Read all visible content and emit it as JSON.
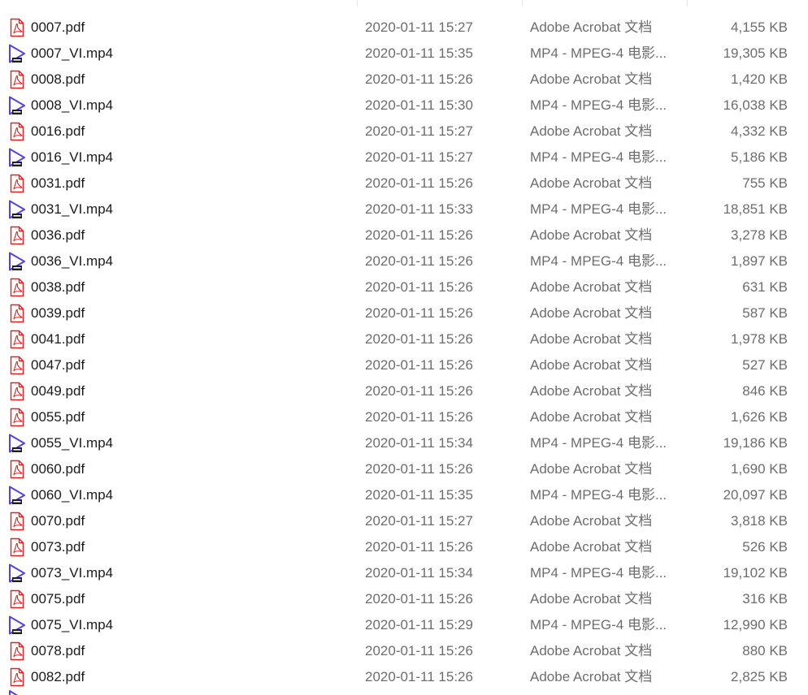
{
  "colors": {
    "pdf_icon": "#e02020",
    "video_icon": "#5b3fd6",
    "name_text": "#1a1a1a",
    "meta_text": "#6d6d6d"
  },
  "icons": {
    "pdf": "pdf-file-icon",
    "video": "mp4-video-file-icon"
  },
  "files": [
    {
      "name": "0007.pdf",
      "date": "2020-01-11 15:27",
      "type": "Adobe Acrobat 文档",
      "size": "4,155 KB",
      "icon": "pdf"
    },
    {
      "name": "0007_VI.mp4",
      "date": "2020-01-11 15:35",
      "type": "MP4 - MPEG-4 电影...",
      "size": "19,305 KB",
      "icon": "video"
    },
    {
      "name": "0008.pdf",
      "date": "2020-01-11 15:26",
      "type": "Adobe Acrobat 文档",
      "size": "1,420 KB",
      "icon": "pdf"
    },
    {
      "name": "0008_VI.mp4",
      "date": "2020-01-11 15:30",
      "type": "MP4 - MPEG-4 电影...",
      "size": "16,038 KB",
      "icon": "video"
    },
    {
      "name": "0016.pdf",
      "date": "2020-01-11 15:27",
      "type": "Adobe Acrobat 文档",
      "size": "4,332 KB",
      "icon": "pdf"
    },
    {
      "name": "0016_VI.mp4",
      "date": "2020-01-11 15:27",
      "type": "MP4 - MPEG-4 电影...",
      "size": "5,186 KB",
      "icon": "video"
    },
    {
      "name": "0031.pdf",
      "date": "2020-01-11 15:26",
      "type": "Adobe Acrobat 文档",
      "size": "755 KB",
      "icon": "pdf"
    },
    {
      "name": "0031_VI.mp4",
      "date": "2020-01-11 15:33",
      "type": "MP4 - MPEG-4 电影...",
      "size": "18,851 KB",
      "icon": "video"
    },
    {
      "name": "0036.pdf",
      "date": "2020-01-11 15:26",
      "type": "Adobe Acrobat 文档",
      "size": "3,278 KB",
      "icon": "pdf"
    },
    {
      "name": "0036_VI.mp4",
      "date": "2020-01-11 15:26",
      "type": "MP4 - MPEG-4 电影...",
      "size": "1,897 KB",
      "icon": "video"
    },
    {
      "name": "0038.pdf",
      "date": "2020-01-11 15:26",
      "type": "Adobe Acrobat 文档",
      "size": "631 KB",
      "icon": "pdf"
    },
    {
      "name": "0039.pdf",
      "date": "2020-01-11 15:26",
      "type": "Adobe Acrobat 文档",
      "size": "587 KB",
      "icon": "pdf"
    },
    {
      "name": "0041.pdf",
      "date": "2020-01-11 15:26",
      "type": "Adobe Acrobat 文档",
      "size": "1,978 KB",
      "icon": "pdf"
    },
    {
      "name": "0047.pdf",
      "date": "2020-01-11 15:26",
      "type": "Adobe Acrobat 文档",
      "size": "527 KB",
      "icon": "pdf"
    },
    {
      "name": "0049.pdf",
      "date": "2020-01-11 15:26",
      "type": "Adobe Acrobat 文档",
      "size": "846 KB",
      "icon": "pdf"
    },
    {
      "name": "0055.pdf",
      "date": "2020-01-11 15:26",
      "type": "Adobe Acrobat 文档",
      "size": "1,626 KB",
      "icon": "pdf"
    },
    {
      "name": "0055_VI.mp4",
      "date": "2020-01-11 15:34",
      "type": "MP4 - MPEG-4 电影...",
      "size": "19,186 KB",
      "icon": "video"
    },
    {
      "name": "0060.pdf",
      "date": "2020-01-11 15:26",
      "type": "Adobe Acrobat 文档",
      "size": "1,690 KB",
      "icon": "pdf"
    },
    {
      "name": "0060_VI.mp4",
      "date": "2020-01-11 15:35",
      "type": "MP4 - MPEG-4 电影...",
      "size": "20,097 KB",
      "icon": "video"
    },
    {
      "name": "0070.pdf",
      "date": "2020-01-11 15:27",
      "type": "Adobe Acrobat 文档",
      "size": "3,818 KB",
      "icon": "pdf"
    },
    {
      "name": "0073.pdf",
      "date": "2020-01-11 15:26",
      "type": "Adobe Acrobat 文档",
      "size": "526 KB",
      "icon": "pdf"
    },
    {
      "name": "0073_VI.mp4",
      "date": "2020-01-11 15:34",
      "type": "MP4 - MPEG-4 电影...",
      "size": "19,102 KB",
      "icon": "video"
    },
    {
      "name": "0075.pdf",
      "date": "2020-01-11 15:26",
      "type": "Adobe Acrobat 文档",
      "size": "316 KB",
      "icon": "pdf"
    },
    {
      "name": "0075_VI.mp4",
      "date": "2020-01-11 15:29",
      "type": "MP4 - MPEG-4 电影...",
      "size": "12,990 KB",
      "icon": "video"
    },
    {
      "name": "0078.pdf",
      "date": "2020-01-11 15:26",
      "type": "Adobe Acrobat 文档",
      "size": "880 KB",
      "icon": "pdf"
    },
    {
      "name": "0082.pdf",
      "date": "2020-01-11 15:26",
      "type": "Adobe Acrobat 文档",
      "size": "2,825 KB",
      "icon": "pdf"
    }
  ]
}
